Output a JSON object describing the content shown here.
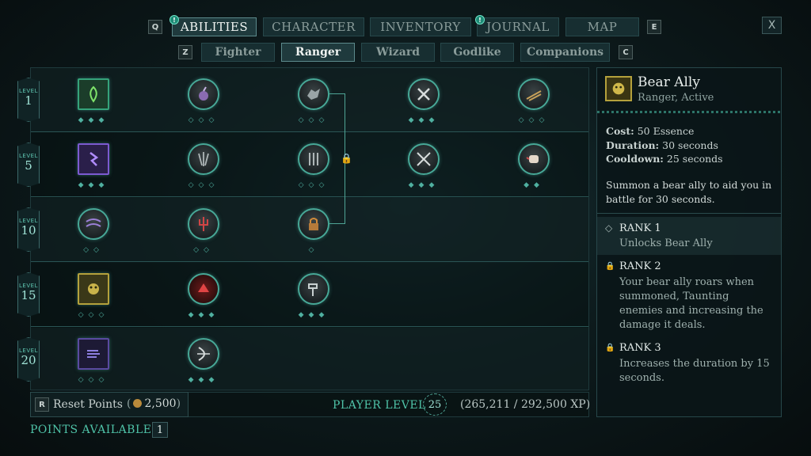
{
  "tabs": {
    "left_key": "Q",
    "right_key": "E",
    "items": [
      {
        "label": "ABILITIES",
        "notify": "!"
      },
      {
        "label": "CHARACTER"
      },
      {
        "label": "INVENTORY"
      },
      {
        "label": "JOURNAL",
        "notify": "!"
      },
      {
        "label": "MAP"
      }
    ],
    "close_label": "X"
  },
  "subtabs": {
    "left_key": "Z",
    "right_key": "C",
    "items": [
      "Fighter",
      "Ranger",
      "Wizard",
      "Godlike",
      "Companions"
    ]
  },
  "levels": [
    {
      "word": "LEVEL",
      "num": "1"
    },
    {
      "word": "LEVEL",
      "num": "5"
    },
    {
      "word": "LEVEL",
      "num": "10"
    },
    {
      "word": "LEVEL",
      "num": "15"
    },
    {
      "word": "LEVEL",
      "num": "20"
    }
  ],
  "pips": {
    "three": "◇◇◇",
    "three_filled": "◆◆◆",
    "two": "◇◇",
    "one": "◇",
    "two_filled": "◆◆"
  },
  "bottom": {
    "reset_key": "R",
    "reset_label": "Reset Points",
    "reset_cost": "2,500",
    "player_level_label": "PLAYER LEVEL",
    "player_level": "25",
    "xp": "(265,211 / 292,500 XP)",
    "points_label": "POINTS AVAILABLE",
    "points": "1"
  },
  "detail": {
    "name": "Bear Ally",
    "subtitle": "Ranger, Active",
    "cost_label": "Cost:",
    "cost": "50 Essence",
    "duration_label": "Duration:",
    "duration": "30 seconds",
    "cooldown_label": "Cooldown:",
    "cooldown": "25 seconds",
    "description": "Summon a bear ally to aid you in battle for 30 seconds.",
    "ranks": [
      {
        "title": "RANK 1",
        "text": "Unlocks Bear Ally",
        "icon": "diamond-icon"
      },
      {
        "title": "RANK 2",
        "text": "Your bear ally roars when summoned, Taunting enemies and increasing the damage it deals.",
        "icon": "lock-icon"
      },
      {
        "title": "RANK 3",
        "text": "Increases the duration by 15 seconds.",
        "icon": "lock-icon"
      }
    ]
  },
  "colors": {
    "accent": "#47a897",
    "lock": "#d08a3a",
    "tab_active": "#f0f4f2"
  }
}
